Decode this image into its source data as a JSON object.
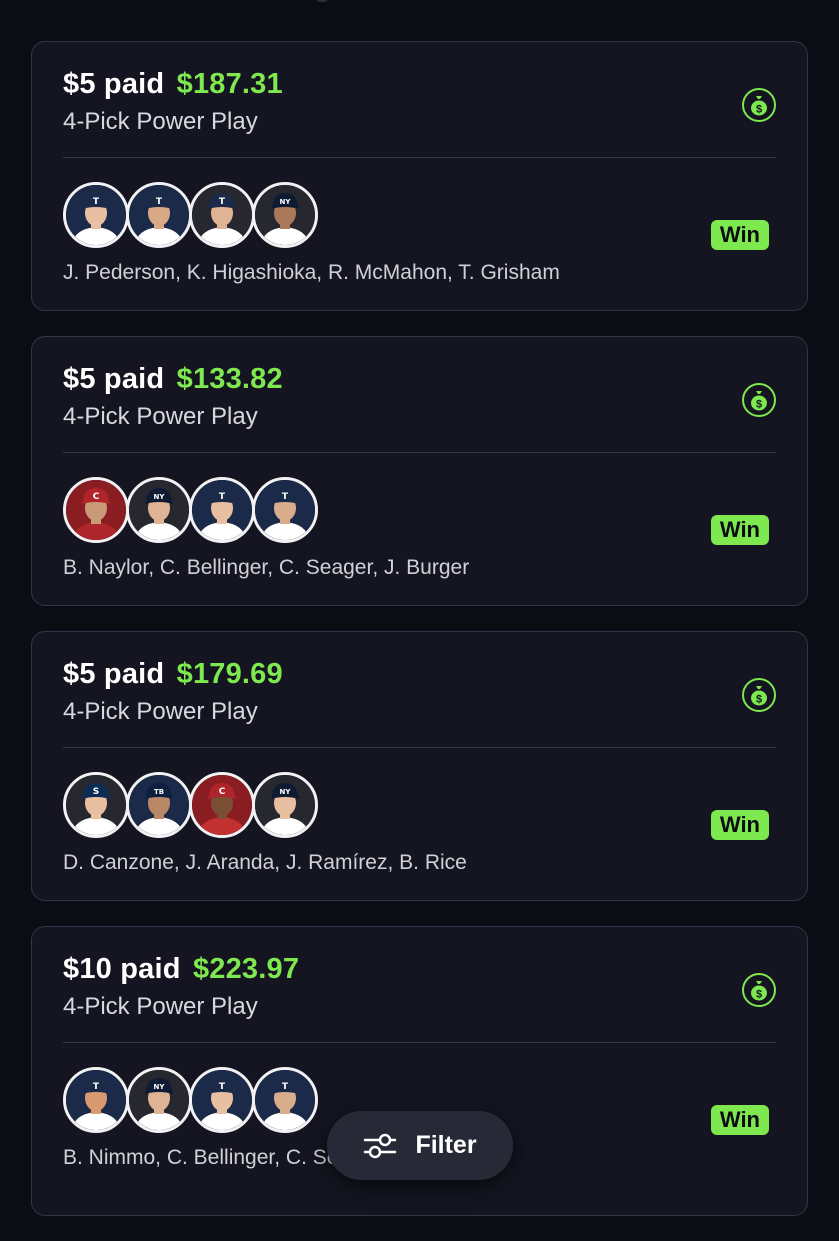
{
  "colors": {
    "accent": "#7ee84f",
    "background": "#0b0c14",
    "card": "#141520"
  },
  "entries": [
    {
      "paid": "$5 paid",
      "payout": "$187.31",
      "play_type": "4-Pick Power Play",
      "status": "Win",
      "players": "J. Pederson, K. Higashioka, R. McMahon, T. Grisham",
      "avatars": [
        {
          "bg": "#1b2a48",
          "cap": "#1b2a48",
          "skin": "#e8bfa0",
          "jersey": "#ffffff",
          "logo": "T"
        },
        {
          "bg": "#1b2a48",
          "cap": "#1b2a48",
          "skin": "#d9a985",
          "jersey": "#ffffff",
          "logo": "T"
        },
        {
          "bg": "#26272f",
          "cap": "#1b2a48",
          "skin": "#e0b394",
          "jersey": "#ffffff",
          "logo": "T"
        },
        {
          "bg": "#26272f",
          "cap": "#0f1a33",
          "skin": "#a9795a",
          "jersey": "#ffffff",
          "logo": "NY"
        }
      ]
    },
    {
      "paid": "$5 paid",
      "payout": "$133.82",
      "play_type": "4-Pick Power Play",
      "status": "Win",
      "players": "B. Naylor, C. Bellinger, C. Seager, J. Burger",
      "avatars": [
        {
          "bg": "#8a1d22",
          "cap": "#b0252b",
          "skin": "#c99a78",
          "jersey": "#b0252b",
          "logo": "C"
        },
        {
          "bg": "#26272f",
          "cap": "#0f1a33",
          "skin": "#e0b394",
          "jersey": "#ffffff",
          "logo": "NY"
        },
        {
          "bg": "#1b2a48",
          "cap": "#1b2a48",
          "skin": "#e8bfa0",
          "jersey": "#ffffff",
          "logo": "T"
        },
        {
          "bg": "#1b2a48",
          "cap": "#1b2a48",
          "skin": "#d9ad8c",
          "jersey": "#ffffff",
          "logo": "T"
        }
      ]
    },
    {
      "paid": "$5 paid",
      "payout": "$179.69",
      "play_type": "4-Pick Power Play",
      "status": "Win",
      "players": "D. Canzone, J. Aranda, J. Ramírez, B. Rice",
      "avatars": [
        {
          "bg": "#26272f",
          "cap": "#0c2c56",
          "skin": "#e8bfa0",
          "jersey": "#ffffff",
          "logo": "S"
        },
        {
          "bg": "#1b2a48",
          "cap": "#0c1f3f",
          "skin": "#b98866",
          "jersey": "#ffffff",
          "logo": "TB"
        },
        {
          "bg": "#8a1d22",
          "cap": "#b0252b",
          "skin": "#7a4e34",
          "jersey": "#c23030",
          "logo": "C"
        },
        {
          "bg": "#26272f",
          "cap": "#0f1a33",
          "skin": "#e8bfa0",
          "jersey": "#ffffff",
          "logo": "NY"
        }
      ]
    },
    {
      "paid": "$10 paid",
      "payout": "$223.97",
      "play_type": "4-Pick Power Play",
      "status": "Win",
      "players": "B. Nimmo, C. Bellinger, C. Seager, J. Burger",
      "avatars": [
        {
          "bg": "#1b2a48",
          "cap": "#1b2a48",
          "skin": "#d99a72",
          "jersey": "#ffffff",
          "logo": "T"
        },
        {
          "bg": "#26272f",
          "cap": "#0f1a33",
          "skin": "#e0b394",
          "jersey": "#ffffff",
          "logo": "NY"
        },
        {
          "bg": "#1b2a48",
          "cap": "#1b2a48",
          "skin": "#e8bfa0",
          "jersey": "#ffffff",
          "logo": "T"
        },
        {
          "bg": "#1b2a48",
          "cap": "#1b2a48",
          "skin": "#d9ad8c",
          "jersey": "#ffffff",
          "logo": "T"
        }
      ]
    }
  ],
  "filter": {
    "label": "Filter",
    "icon": "sliders-icon"
  }
}
